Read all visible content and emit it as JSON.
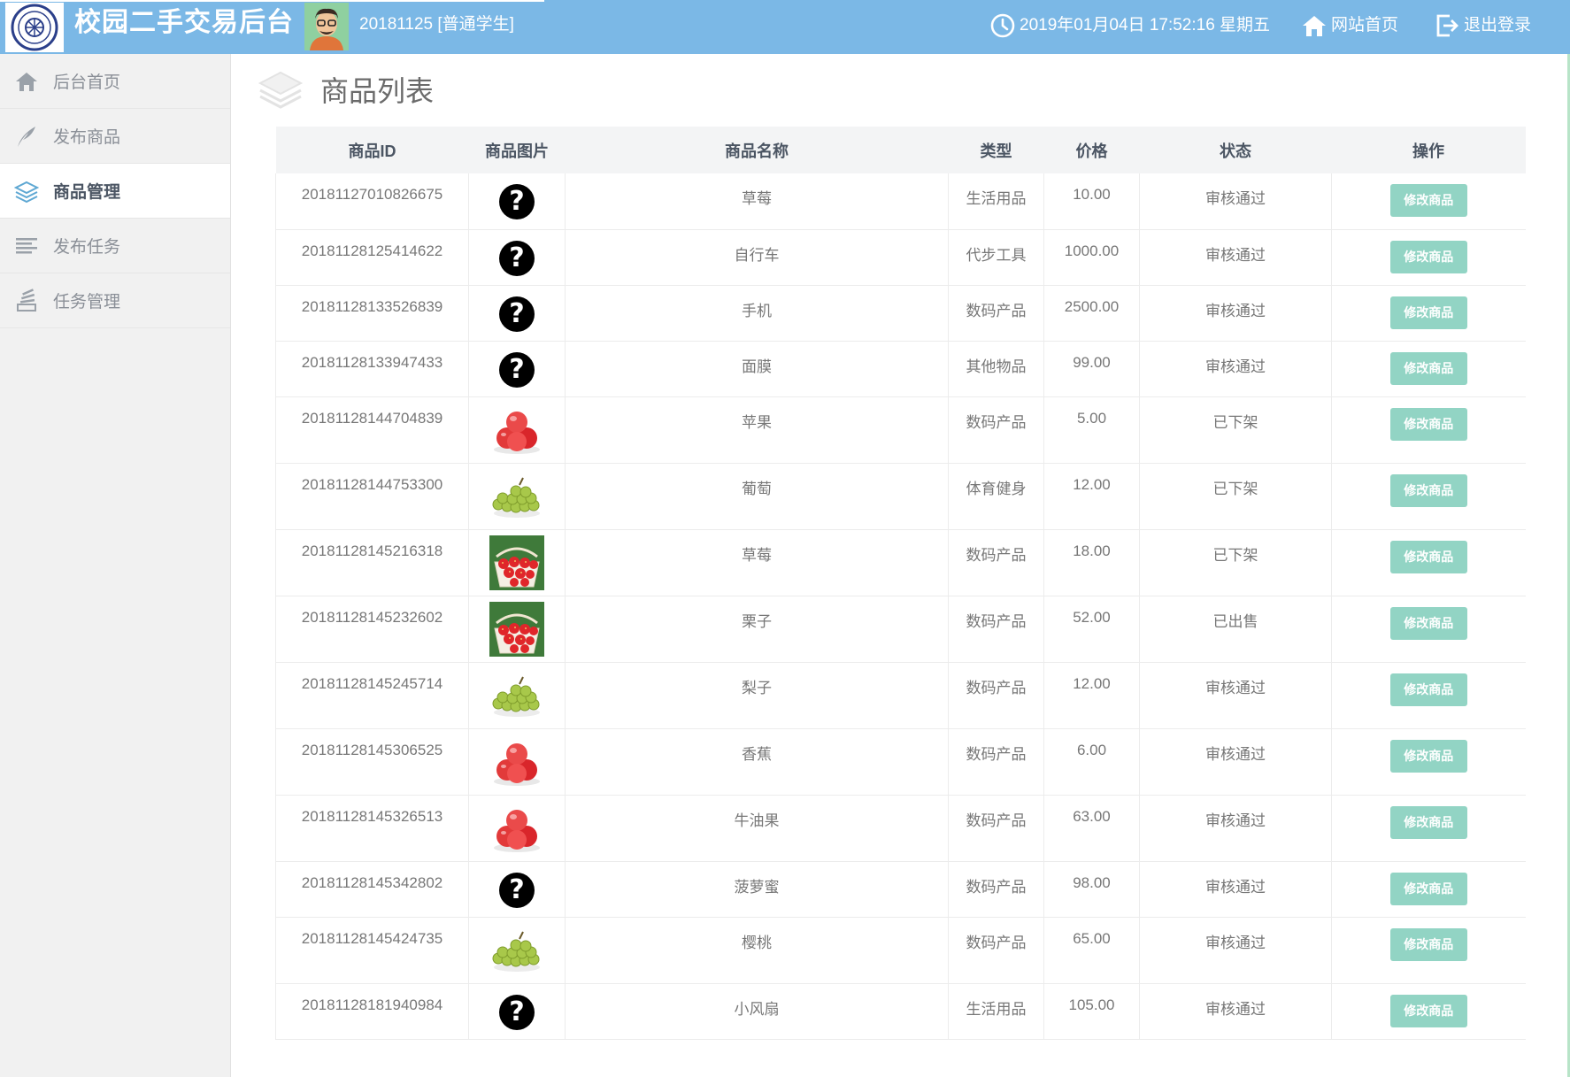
{
  "header": {
    "app_title": "校园二手交易后台",
    "user": "20181125 [普通学生]",
    "datetime": "2019年01月04日 17:52:16 星期五",
    "home_link": "网站首页",
    "logout_link": "退出登录",
    "bg_color": "#7bb8e6"
  },
  "sidebar": {
    "items": [
      {
        "label": "后台首页",
        "icon": "home-icon"
      },
      {
        "label": "发布商品",
        "icon": "feather-icon"
      },
      {
        "label": "商品管理",
        "icon": "layers-icon",
        "active": true
      },
      {
        "label": "发布任务",
        "icon": "list-icon"
      },
      {
        "label": "任务管理",
        "icon": "stack-icon"
      }
    ]
  },
  "page": {
    "title": "商品列表"
  },
  "table": {
    "columns": [
      "商品ID",
      "商品图片",
      "商品名称",
      "类型",
      "价格",
      "状态",
      "操作"
    ],
    "action_label": "修改商品",
    "rows": [
      {
        "id": "20181127010826675",
        "image": "unknown-image-icon",
        "name": "草莓",
        "type": "生活用品",
        "price": "10.00",
        "status": "审核通过"
      },
      {
        "id": "20181128125414622",
        "image": "unknown-image-icon",
        "name": "自行车",
        "type": "代步工具",
        "price": "1000.00",
        "status": "审核通过"
      },
      {
        "id": "20181128133526839",
        "image": "unknown-image-icon",
        "name": "手机",
        "type": "数码产品",
        "price": "2500.00",
        "status": "审核通过"
      },
      {
        "id": "20181128133947433",
        "image": "unknown-image-icon",
        "name": "面膜",
        "type": "其他物品",
        "price": "99.00",
        "status": "审核通过"
      },
      {
        "id": "20181128144704839",
        "image": "apples",
        "name": "苹果",
        "type": "数码产品",
        "price": "5.00",
        "status": "已下架"
      },
      {
        "id": "20181128144753300",
        "image": "grapes",
        "name": "葡萄",
        "type": "体育健身",
        "price": "12.00",
        "status": "已下架"
      },
      {
        "id": "20181128145216318",
        "image": "strawberry-basket",
        "name": "草莓",
        "type": "数码产品",
        "price": "18.00",
        "status": "已下架"
      },
      {
        "id": "20181128145232602",
        "image": "strawberry-basket",
        "name": "栗子",
        "type": "数码产品",
        "price": "52.00",
        "status": "已出售"
      },
      {
        "id": "20181128145245714",
        "image": "grapes",
        "name": "梨子",
        "type": "数码产品",
        "price": "12.00",
        "status": "审核通过"
      },
      {
        "id": "20181128145306525",
        "image": "apples",
        "name": "香蕉",
        "type": "数码产品",
        "price": "6.00",
        "status": "审核通过"
      },
      {
        "id": "20181128145326513",
        "image": "apples",
        "name": "牛油果",
        "type": "数码产品",
        "price": "63.00",
        "status": "审核通过"
      },
      {
        "id": "20181128145342802",
        "image": "unknown-image-icon",
        "name": "菠萝蜜",
        "type": "数码产品",
        "price": "98.00",
        "status": "审核通过"
      },
      {
        "id": "20181128145424735",
        "image": "grapes",
        "name": "樱桃",
        "type": "数码产品",
        "price": "65.00",
        "status": "审核通过"
      },
      {
        "id": "20181128181940984",
        "image": "unknown-image-icon",
        "name": "小风扇",
        "type": "生活用品",
        "price": "105.00",
        "status": "审核通过"
      }
    ]
  }
}
